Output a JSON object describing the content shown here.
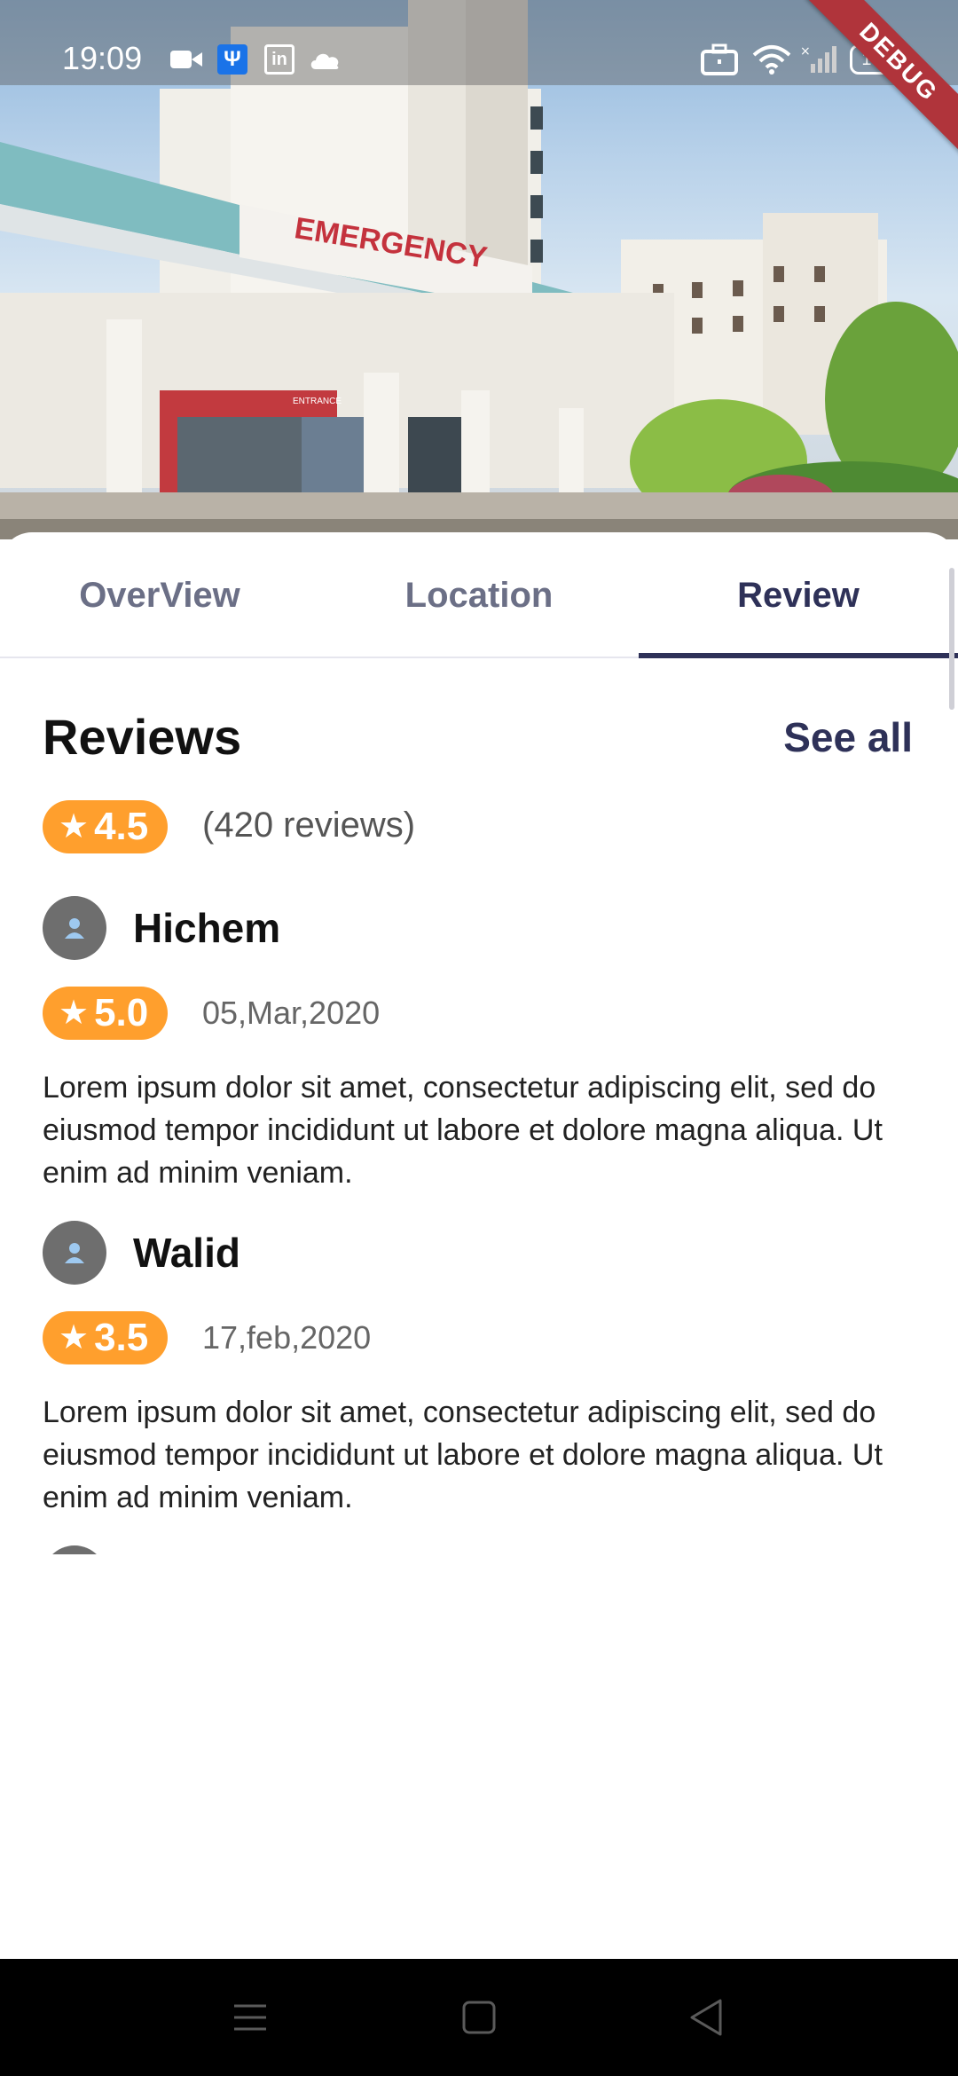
{
  "status_bar": {
    "time": "19:09",
    "usb_glyph": "Ψ",
    "linkedin_glyph": "in",
    "battery": "100",
    "icons": [
      "video-icon",
      "usb-icon",
      "linkedin-icon",
      "cloud-icon",
      "briefcase-icon",
      "wifi-icon",
      "signal-icon",
      "battery-icon"
    ]
  },
  "debug_banner": "DEBUG",
  "hero": {
    "sign_text": "EMERGENCY",
    "entrance_text": "ENTRANCE"
  },
  "tabs": [
    {
      "label": "OverView",
      "active": false
    },
    {
      "label": "Location",
      "active": false
    },
    {
      "label": "Review",
      "active": true
    }
  ],
  "reviews": {
    "title": "Reviews",
    "see_all": "See all",
    "summary": {
      "star": "★",
      "rating": "4.5",
      "count_text": "(420 reviews)"
    },
    "items": [
      {
        "name": "Hichem",
        "star": "★",
        "rating": "5.0",
        "date": "05,Mar,2020",
        "text": "Lorem ipsum dolor sit amet, consectetur adipiscing elit, sed do eiusmod tempor incididunt ut labore et dolore magna aliqua. Ut enim ad minim veniam."
      },
      {
        "name": "Walid",
        "star": "★",
        "rating": "3.5",
        "date": "17,feb,2020",
        "text": "Lorem ipsum dolor sit amet, consectetur adipiscing elit, sed do eiusmod tempor incididunt ut labore et dolore magna aliqua. Ut enim ad minim veniam."
      }
    ]
  },
  "colors": {
    "accent": "#2e3158",
    "rating_badge": "#ff9f2d",
    "tab_inactive": "#6b6f86",
    "debug_ribbon": "#b0343b"
  },
  "nav_bar": {
    "icons": [
      "menu-icon",
      "home-square-icon",
      "back-triangle-icon"
    ]
  }
}
